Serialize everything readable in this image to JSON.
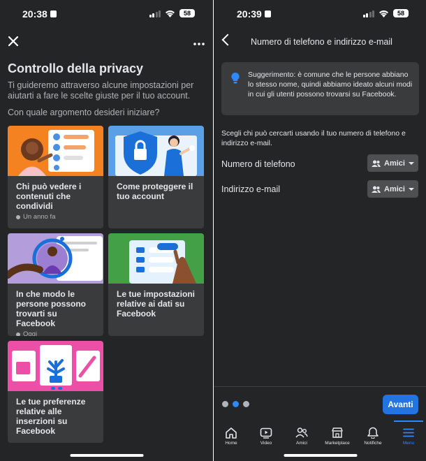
{
  "left": {
    "status": {
      "time": "20:38",
      "battery": "58"
    },
    "title": "Controllo della privacy",
    "intro": "Ti guideremo attraverso alcune impostazioni per aiutarti a fare le scelte giuste per il tuo account.",
    "question": "Con quale argomento desideri iniziare?",
    "cards": [
      {
        "label": "Chi può vedere i contenuti che condividi",
        "meta": "Un anno fa"
      },
      {
        "label": "Come proteggere il tuo account",
        "meta": ""
      },
      {
        "label": "In che modo le persone possono trovarti su Facebook",
        "meta": "Oggi"
      },
      {
        "label": "Le tue impostazioni relative ai dati su Facebook",
        "meta": ""
      },
      {
        "label": "Le tue preferenze relative alle inserzioni su Facebook",
        "meta": ""
      }
    ]
  },
  "right": {
    "status": {
      "time": "20:39",
      "battery": "58"
    },
    "header_title": "Numero di telefono e indirizzo e-mail",
    "tip": "Suggerimento: è comune che le persone abbiano lo stesso nome, quindi abbiamo ideato alcuni modi in cui gli utenti possono trovarsi su Facebook.",
    "choose": "Scegli chi può cercarti usando il tuo numero di telefono e indirizzo e-mail.",
    "rows": [
      {
        "label": "Numero di telefono",
        "audience": "Amici"
      },
      {
        "label": "Indirizzo e-mail",
        "audience": "Amici"
      }
    ],
    "progress": {
      "steps": 3,
      "current": 2
    },
    "next_label": "Avanti",
    "tabs": [
      {
        "label": "Home",
        "icon": "home-icon"
      },
      {
        "label": "Video",
        "icon": "video-icon"
      },
      {
        "label": "Amici",
        "icon": "friends-icon"
      },
      {
        "label": "Marketplace",
        "icon": "marketplace-icon"
      },
      {
        "label": "Notifiche",
        "icon": "bell-icon"
      },
      {
        "label": "Menu",
        "icon": "menu-icon",
        "active": true
      }
    ],
    "accent": "#2374e1"
  }
}
